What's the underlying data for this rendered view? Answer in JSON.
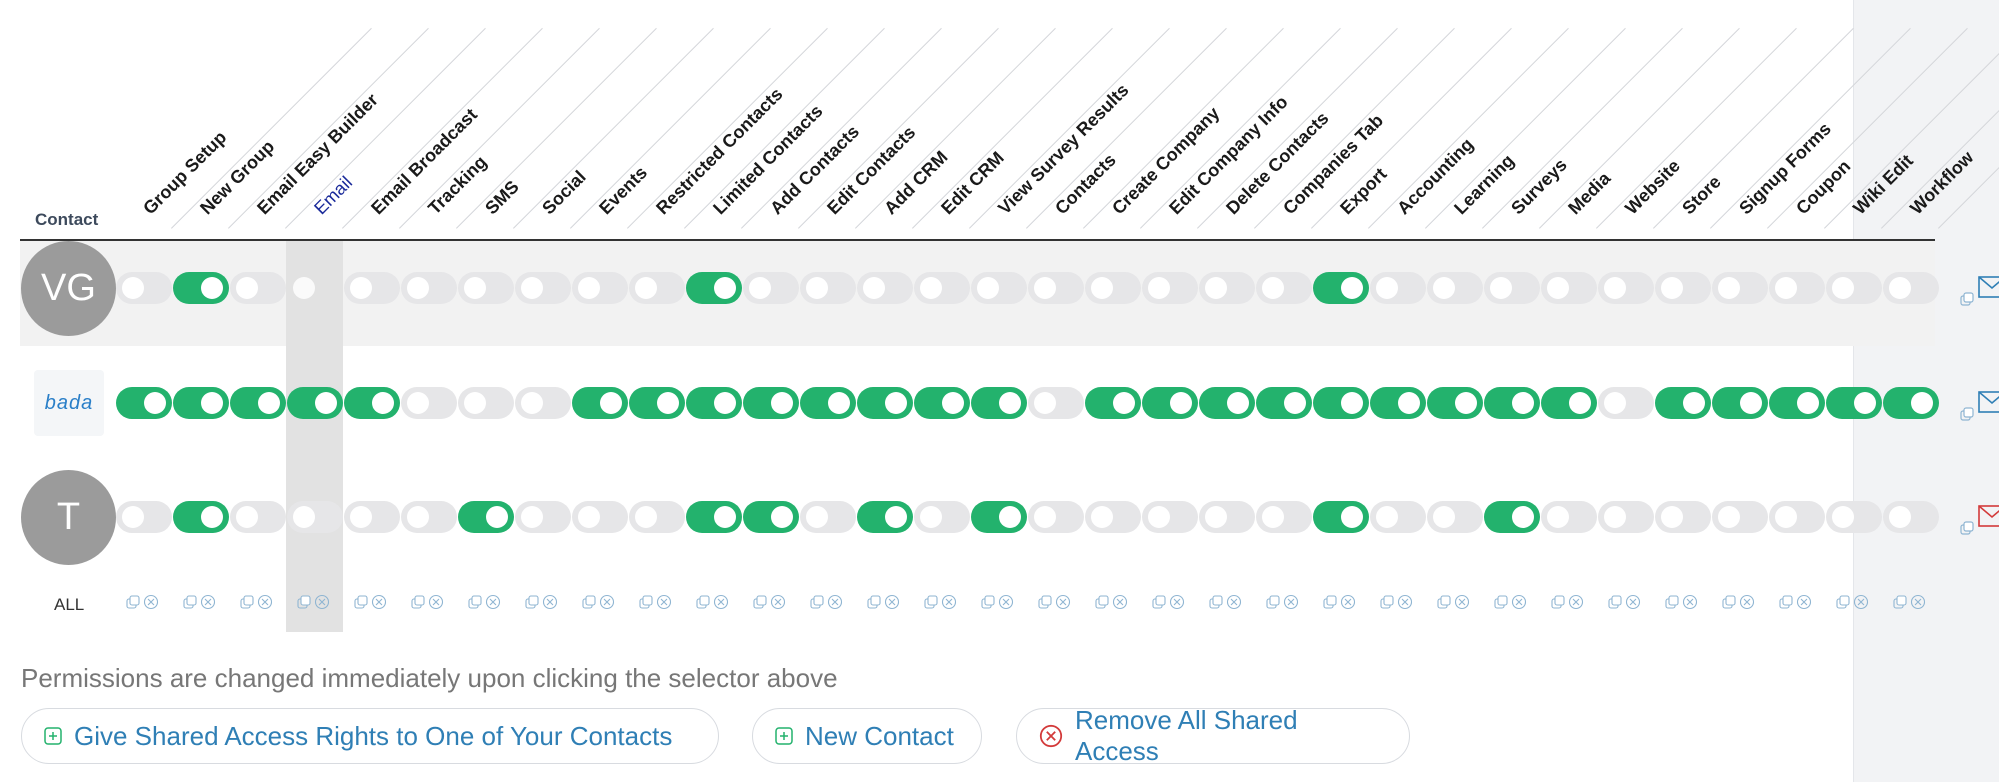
{
  "header": {
    "contact_label": "Contact"
  },
  "columns": [
    "Group Setup",
    "New Group",
    "Email Easy Builder",
    "Email",
    "Email Broadcast",
    "Tracking",
    "SMS",
    "Social",
    "Events",
    "Restricted Contacts",
    "Limited Contacts",
    "Add Contacts",
    "Edit Contacts",
    "Add CRM",
    "Edit CRM",
    "View Survey Results",
    "Contacts",
    "Create Company",
    "Edit Company Info",
    "Delete Contacts",
    "Companies Tab",
    "Export",
    "Accounting",
    "Learning",
    "Surveys",
    "Media",
    "Website",
    "Store",
    "Signup Forms",
    "Coupon",
    "Wiki Edit",
    "Workflow"
  ],
  "highlighted_column": "Email",
  "rows": [
    {
      "avatar_type": "initials",
      "initials": "VG",
      "shaded": true,
      "envelope_color": "#2f7fb5",
      "toggles": [
        false,
        true,
        false,
        null,
        false,
        false,
        false,
        false,
        false,
        false,
        true,
        false,
        false,
        false,
        false,
        false,
        false,
        false,
        false,
        false,
        false,
        true,
        false,
        false,
        false,
        false,
        false,
        false,
        false,
        false,
        false,
        false
      ]
    },
    {
      "avatar_type": "logo",
      "logo_text": "bada",
      "shaded": false,
      "envelope_color": "#2f7fb5",
      "toggles": [
        true,
        true,
        true,
        true,
        true,
        false,
        false,
        false,
        true,
        true,
        true,
        true,
        true,
        true,
        true,
        true,
        false,
        true,
        true,
        true,
        true,
        true,
        true,
        true,
        true,
        true,
        false,
        true,
        true,
        true,
        true,
        true
      ]
    },
    {
      "avatar_type": "initials",
      "initials": "T",
      "shaded": false,
      "envelope_color": "#d33a3a",
      "toggles": [
        false,
        true,
        false,
        false,
        false,
        false,
        true,
        false,
        false,
        false,
        true,
        true,
        false,
        true,
        false,
        true,
        false,
        false,
        false,
        false,
        false,
        true,
        false,
        false,
        true,
        false,
        false,
        false,
        false,
        false,
        false,
        false
      ]
    }
  ],
  "all_row_label": "ALL",
  "note": "Permissions are changed immediately upon clicking the selector above",
  "buttons": {
    "give_access": "Give Shared Access Rights to One of Your Contacts",
    "new_contact": "New Contact",
    "remove_all": "Remove All Shared Access"
  },
  "colors": {
    "toggle_on": "#23b26d",
    "toggle_off": "#e6e6e8",
    "link": "#2f7fb5",
    "danger": "#d33a3a"
  },
  "icons": {
    "add": "plus-square-icon",
    "remove": "x-circle-icon",
    "email": "envelope-icon"
  }
}
